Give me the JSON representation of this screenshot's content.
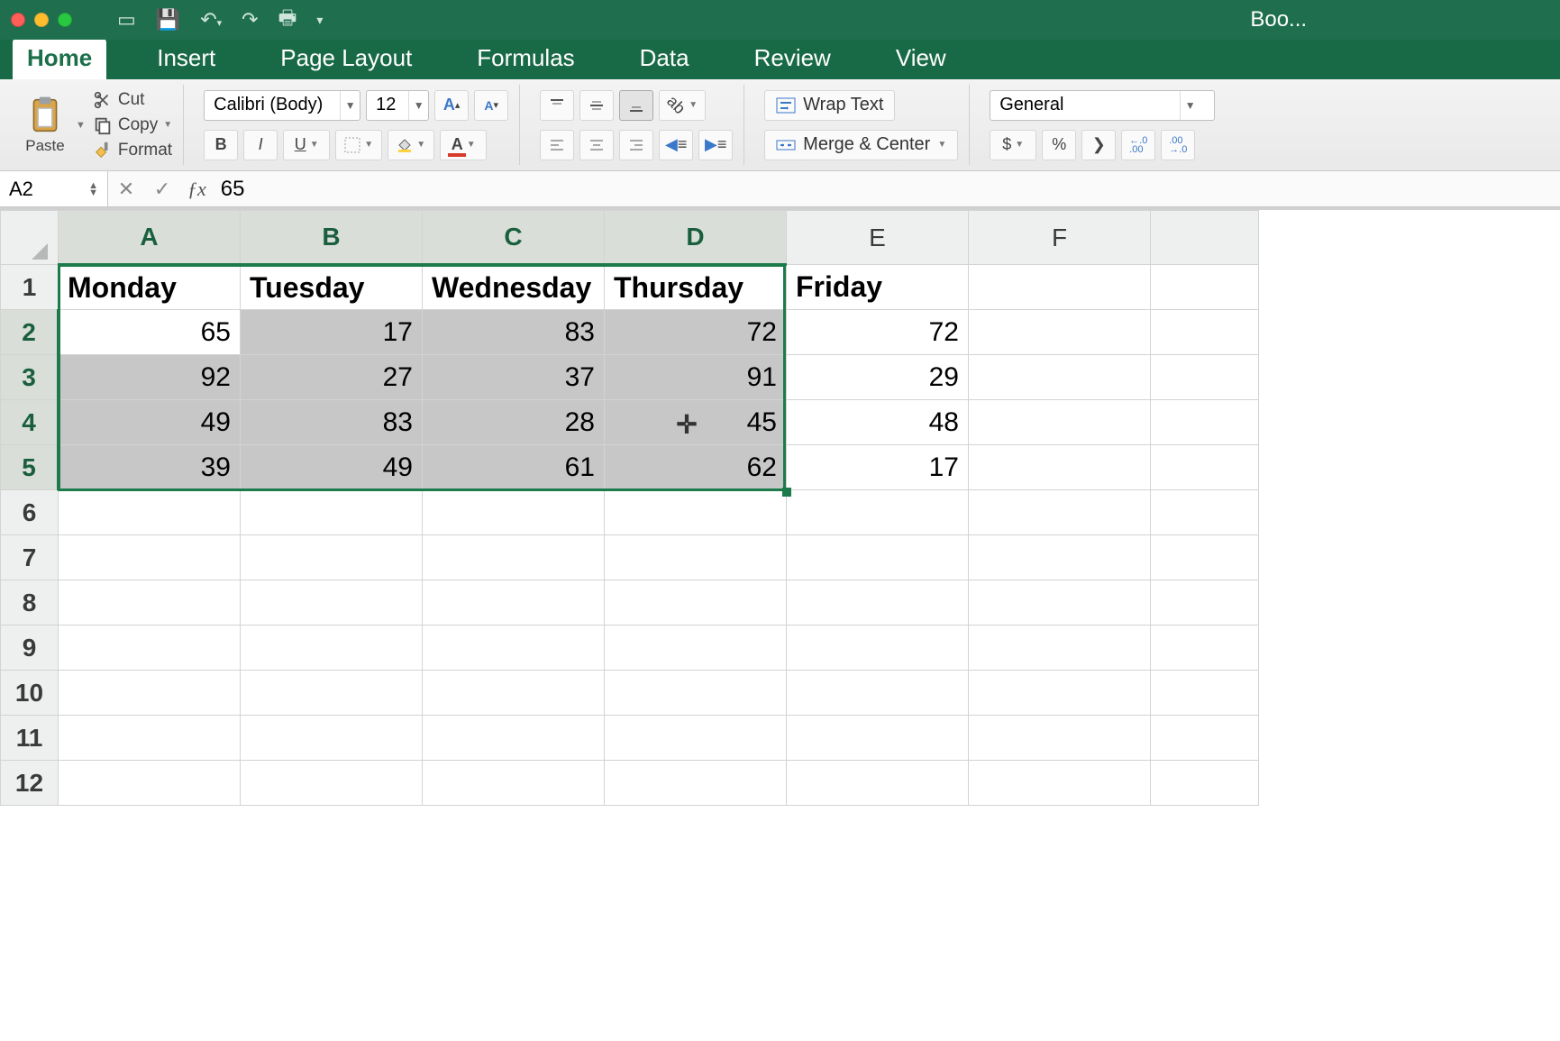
{
  "window": {
    "title": "Boo..."
  },
  "tabs": {
    "home": "Home",
    "insert": "Insert",
    "page_layout": "Page Layout",
    "formulas": "Formulas",
    "data": "Data",
    "review": "Review",
    "view": "View"
  },
  "ribbon": {
    "paste": "Paste",
    "cut": "Cut",
    "copy": "Copy",
    "format": "Format",
    "font_name": "Calibri (Body)",
    "font_size": "12",
    "wrap_text": "Wrap Text",
    "merge_center": "Merge & Center",
    "number_format": "General",
    "currency": "$",
    "percent": "%",
    "comma": "❯",
    "inc_dec_left": ".0\n.00",
    "inc_dec_right": ".00\n.0"
  },
  "formula_bar": {
    "name_box": "A2",
    "formula": "65"
  },
  "columns": [
    "A",
    "B",
    "C",
    "D",
    "E",
    "F"
  ],
  "sel_cols": [
    "A",
    "B",
    "C",
    "D"
  ],
  "sel_rows": [
    2,
    3,
    4,
    5
  ],
  "active_cell": "A2",
  "grid": {
    "headers": [
      "Monday",
      "Tuesday",
      "Wednesday",
      "Thursday",
      "Friday"
    ],
    "rows": [
      [
        65,
        17,
        83,
        72,
        72
      ],
      [
        92,
        27,
        37,
        91,
        29
      ],
      [
        49,
        83,
        28,
        45,
        48
      ],
      [
        39,
        49,
        61,
        62,
        17
      ]
    ]
  },
  "chart_data": {
    "type": "table",
    "title": "",
    "columns": [
      "Monday",
      "Tuesday",
      "Wednesday",
      "Thursday",
      "Friday"
    ],
    "data": [
      {
        "Monday": 65,
        "Tuesday": 17,
        "Wednesday": 83,
        "Thursday": 72,
        "Friday": 72
      },
      {
        "Monday": 92,
        "Tuesday": 27,
        "Wednesday": 37,
        "Thursday": 91,
        "Friday": 29
      },
      {
        "Monday": 49,
        "Tuesday": 83,
        "Wednesday": 28,
        "Thursday": 45,
        "Friday": 48
      },
      {
        "Monday": 39,
        "Tuesday": 49,
        "Wednesday": 61,
        "Thursday": 62,
        "Friday": 17
      }
    ]
  }
}
